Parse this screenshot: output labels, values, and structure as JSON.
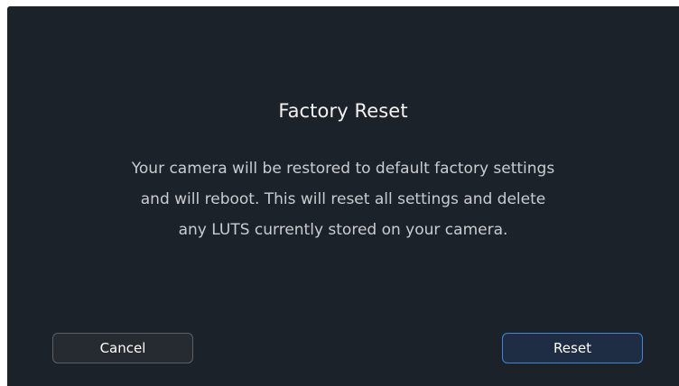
{
  "dialog": {
    "title": "Factory Reset",
    "message_lines": [
      "Your camera will be restored to default factory settings",
      "and will reboot. This will reset all settings and delete",
      "any LUTS currently stored on your camera."
    ],
    "cancel_label": "Cancel",
    "reset_label": "Reset"
  },
  "colors": {
    "background": "#1c2229",
    "accent_border": "#3d86d9",
    "neutral_border": "#5b6066",
    "title_text": "#f2f2f2",
    "body_text": "#c9cdd1"
  }
}
